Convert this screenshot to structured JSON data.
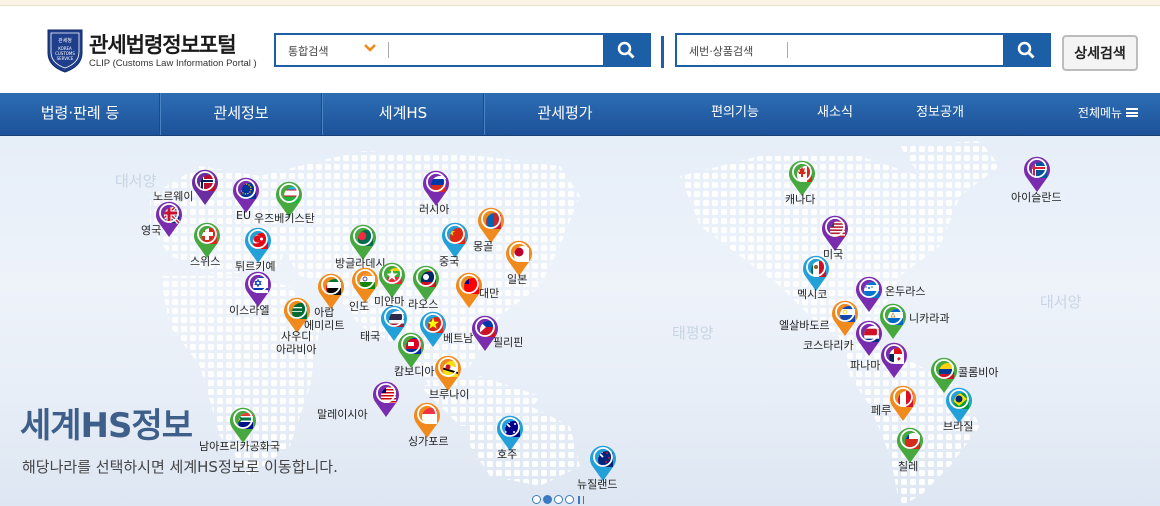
{
  "header": {
    "logo_badge": "관세청 KOREA CUSTOMS SERVICE",
    "title": "관세법령정보포털",
    "subtitle": "CLIP (Customs Law Information Portal )",
    "search1": {
      "scope": "통합검색",
      "placeholder": ""
    },
    "search2": {
      "scope": "세번·상품검색",
      "placeholder": ""
    },
    "detail_search": "상세검색"
  },
  "nav": {
    "items": [
      "법령·판례 등",
      "관세정보",
      "세계HS",
      "관세평가",
      "편의기능",
      "새소식",
      "정보공개",
      "전체메뉴"
    ]
  },
  "map": {
    "oceans": [
      "대서양",
      "태평양",
      "대서양"
    ],
    "title": "세계HS정보",
    "description": "해당나라를 선택하시면 세계HS정보로 이동합니다.",
    "countries": [
      "노르웨이",
      "영국",
      "EU",
      "우즈베키스탄",
      "스위스",
      "튀르키예",
      "이스라엘",
      "사우디 아라비아",
      "아랍 에미리트",
      "방글라데시",
      "인도",
      "미얀마",
      "러시아",
      "중국",
      "몽골",
      "일본",
      "대만",
      "라오스",
      "태국",
      "베트남",
      "필리핀",
      "캄보디아",
      "브루나이",
      "말레이시아",
      "싱가포르",
      "남아프리카공화국",
      "호주",
      "뉴질랜드",
      "캐나다",
      "미국",
      "멕시코",
      "온두라스",
      "니카라과",
      "엘살바도르",
      "코스타리카",
      "파나마",
      "콜롬비아",
      "페루",
      "브라질",
      "칠레",
      "아이슬란드"
    ],
    "slider_count": 4,
    "slider_active": 2
  },
  "colors": {
    "brand_blue": "#1d5fa7",
    "accent_orange": "#f08a1c",
    "title_blue": "#3d5f8a"
  }
}
